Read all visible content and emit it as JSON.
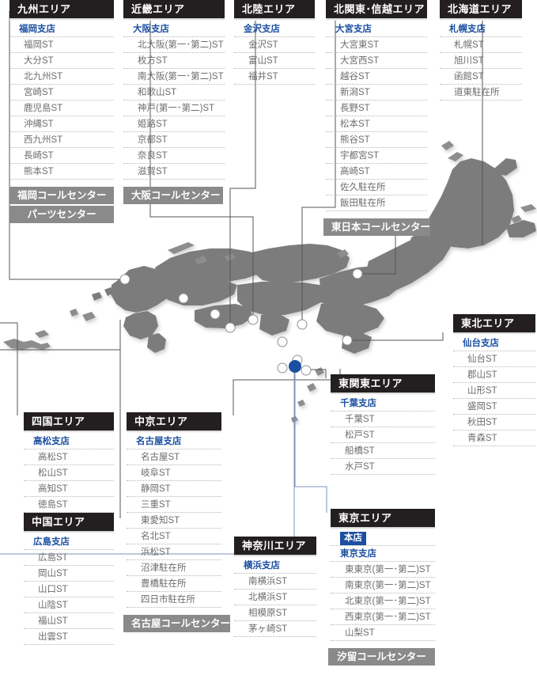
{
  "page": {
    "title": "拠点ネットワーク",
    "colors": {
      "header_bg": "#231f20",
      "branch_text": "#1b4fa0",
      "hq_badge_bg": "#1b4fa0",
      "callcenter_bg": "#8a8a8a",
      "map_fill": "#7b7b7b",
      "map_fill_light": "#9a9a9a",
      "dot_hq": "#1b4fa0",
      "dot_branch": "#ffffff",
      "connector": "#4a4a4a"
    }
  },
  "areas": [
    {
      "id": "kyushu",
      "header": "九州エリア",
      "branch": "福岡支店",
      "stations": [
        "福岡ST",
        "大分ST",
        "北九州ST",
        "宮崎ST",
        "鹿児島ST",
        "沖縄ST",
        "西九州ST",
        "長崎ST",
        "熊本ST"
      ],
      "callcenters": [
        "福岡コールセンター",
        "パーツセンター"
      ]
    },
    {
      "id": "kinki",
      "header": "近畿エリア",
      "branch": "大阪支店",
      "stations": [
        "北大阪(第一･第二)ST",
        "枚方ST",
        "南大阪(第一･第二)ST",
        "和歌山ST",
        "神戸(第一･第二)ST",
        "姫路ST",
        "京都ST",
        "奈良ST",
        "滋賀ST"
      ],
      "callcenters": [
        "大阪コールセンター"
      ]
    },
    {
      "id": "hokuriku",
      "header": "北陸エリア",
      "branch": "金沢支店",
      "stations": [
        "金沢ST",
        "富山ST",
        "福井ST"
      ],
      "callcenters": []
    },
    {
      "id": "kitakanto",
      "header": "北関東･信越エリア",
      "branch": "大宮支店",
      "stations": [
        "大宮東ST",
        "大宮西ST",
        "越谷ST",
        "新潟ST",
        "長野ST",
        "松本ST",
        "熊谷ST",
        "宇都宮ST",
        "高崎ST",
        "佐久駐在所",
        "飯田駐在所"
      ],
      "callcenters": [
        "東日本コールセンター"
      ]
    },
    {
      "id": "hokkaido",
      "header": "北海道エリア",
      "branch": "札幌支店",
      "stations": [
        "札幌ST",
        "旭川ST",
        "函館ST",
        "道東駐在所"
      ],
      "callcenters": []
    },
    {
      "id": "tohoku",
      "header": "東北エリア",
      "branch": "仙台支店",
      "stations": [
        "仙台ST",
        "郡山ST",
        "山形ST",
        "盛岡ST",
        "秋田ST",
        "青森ST"
      ],
      "callcenters": []
    },
    {
      "id": "shikoku",
      "header": "四国エリア",
      "branch": "高松支店",
      "stations": [
        "高松ST",
        "松山ST",
        "高知ST",
        "徳島ST"
      ],
      "callcenters": []
    },
    {
      "id": "chugoku",
      "header": "中国エリア",
      "branch": "広島支店",
      "stations": [
        "広島ST",
        "岡山ST",
        "山口ST",
        "山陰ST",
        "福山ST",
        "出雲ST"
      ],
      "callcenters": []
    },
    {
      "id": "chukyo",
      "header": "中京エリア",
      "branch": "名古屋支店",
      "stations": [
        "名古屋ST",
        "岐阜ST",
        "静岡ST",
        "三重ST",
        "東愛知ST",
        "名北ST",
        "浜松ST",
        "沼津駐在所",
        "豊橋駐在所",
        "四日市駐在所"
      ],
      "callcenters": [
        "名古屋コールセンター"
      ]
    },
    {
      "id": "higashikanto",
      "header": "東関東エリア",
      "branch": "千葉支店",
      "stations": [
        "千葉ST",
        "松戸ST",
        "船橋ST",
        "水戸ST"
      ],
      "callcenters": []
    },
    {
      "id": "kanagawa",
      "header": "神奈川エリア",
      "branch": "横浜支店",
      "stations": [
        "南横浜ST",
        "北横浜ST",
        "相模原ST",
        "茅ヶ崎ST"
      ],
      "callcenters": []
    },
    {
      "id": "tokyo",
      "header": "東京エリア",
      "hq": "本店",
      "branch": "東京支店",
      "stations": [
        "東東京(第一･第二)ST",
        "南東京(第一･第二)ST",
        "北東京(第一･第二)ST",
        "西東京(第一･第二)ST",
        "山梨ST"
      ],
      "callcenters": [
        "汐留コールセンター"
      ]
    }
  ],
  "map_markers": [
    {
      "name": "fukuoka",
      "type": "branch"
    },
    {
      "name": "hiroshima",
      "type": "branch"
    },
    {
      "name": "takamatsu",
      "type": "branch"
    },
    {
      "name": "osaka",
      "type": "branch"
    },
    {
      "name": "nagoya",
      "type": "branch"
    },
    {
      "name": "kanazawa",
      "type": "branch"
    },
    {
      "name": "yokohama",
      "type": "branch"
    },
    {
      "name": "tokyo-hq",
      "type": "hq"
    },
    {
      "name": "chiba",
      "type": "branch"
    },
    {
      "name": "omiya",
      "type": "branch"
    },
    {
      "name": "sendai",
      "type": "branch"
    },
    {
      "name": "sapporo",
      "type": "branch"
    }
  ]
}
